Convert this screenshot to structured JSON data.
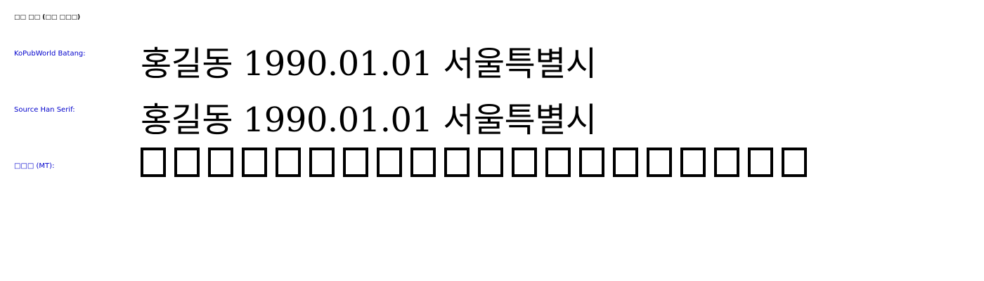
{
  "header": {
    "title": "□□ □□ (□□ □□□)"
  },
  "label_color": "#0000cc",
  "rows": [
    {
      "label": "KoPubWorld Batang:",
      "sample": "홍길동 1990.01.01 서울특별시"
    },
    {
      "label": "Source Han Serif:",
      "sample": "홍길동 1990.01.01 서울특별시"
    },
    {
      "label": "□□□ (MT):",
      "sample": "□□□□□□□□□□□□□□□□□□□□",
      "missing_glyph_count": 20
    }
  ]
}
